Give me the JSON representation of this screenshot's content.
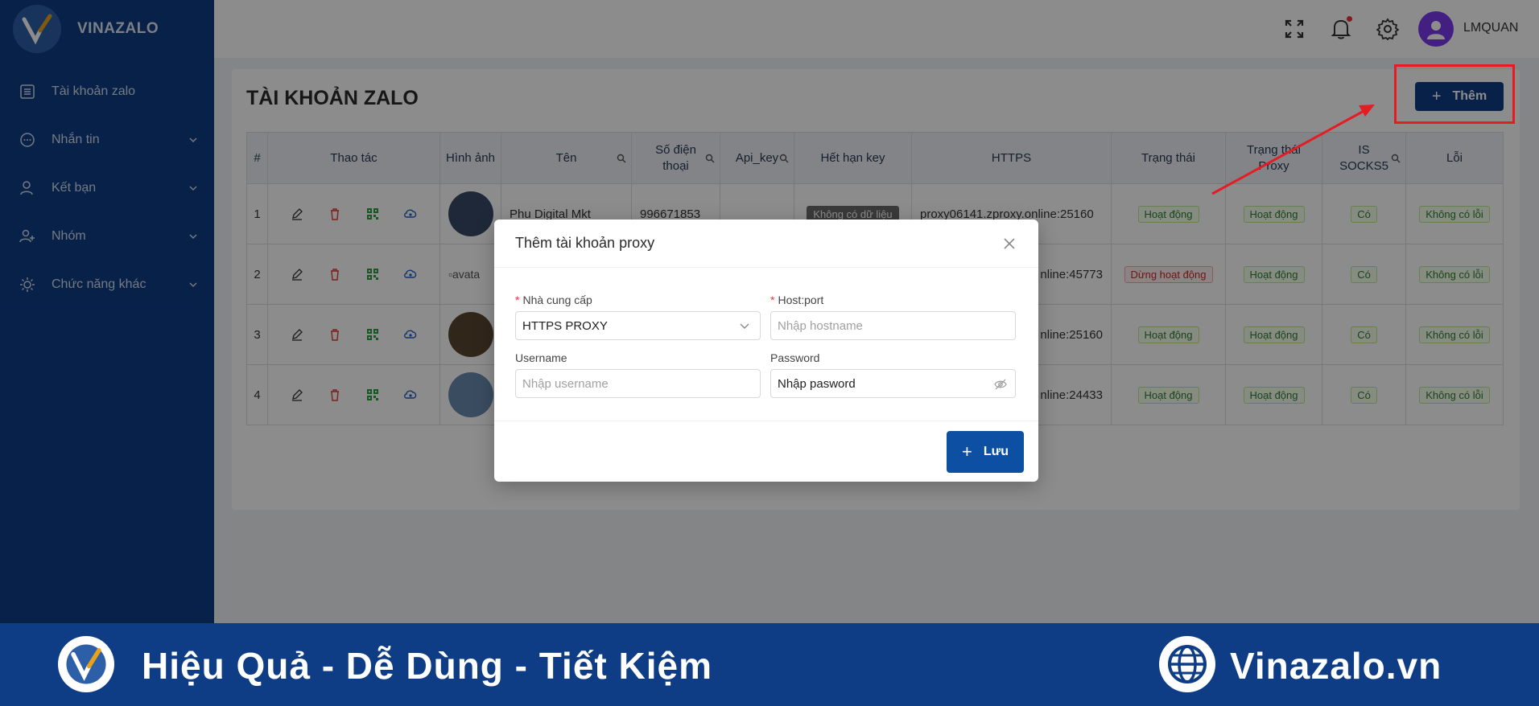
{
  "app": {
    "brand": "VINAZALO",
    "username": "LMQUAN"
  },
  "sidebar": {
    "items": [
      {
        "label": "Tài khoản zalo",
        "icon": "list-icon"
      },
      {
        "label": "Nhắn tin",
        "icon": "chat-icon"
      },
      {
        "label": "Kết bạn",
        "icon": "user-icon"
      },
      {
        "label": "Nhóm",
        "icon": "group-icon"
      },
      {
        "label": "Chức năng khác",
        "icon": "sun-icon"
      }
    ]
  },
  "page": {
    "title": "TÀI KHOẢN ZALO",
    "add_label": "Thêm"
  },
  "table": {
    "headers": [
      "#",
      "Thao tác",
      "Hình ảnh",
      "Tên",
      "Số điện thoại",
      "Api_key",
      "Hết hạn key",
      "HTTPS",
      "Trạng thái",
      "Trạng thái Proxy",
      "IS SOCKS5",
      "Lỗi"
    ],
    "rows": [
      {
        "index": "1",
        "name": "Phu Digital Mkt",
        "phone": "996671853",
        "expiry": "Không có dữ liệu",
        "https": "proxy06141.zproxy.online:25160",
        "status": "Hoạt động",
        "proxy_status": "Hoạt động",
        "socks5": "Có",
        "error": "Không có lỗi"
      },
      {
        "index": "2",
        "image_alt": "avata",
        "https": "nline:45773",
        "status": "Dừng hoạt động",
        "proxy_status": "Hoạt động",
        "socks5": "Có",
        "error": "Không có lỗi"
      },
      {
        "index": "3",
        "https": "nline:25160",
        "status": "Hoạt động",
        "proxy_status": "Hoạt động",
        "socks5": "Có",
        "error": "Không có lỗi"
      },
      {
        "index": "4",
        "https": "nline:24433",
        "status": "Hoạt động",
        "proxy_status": "Hoạt động",
        "socks5": "Có",
        "error": "Không có lỗi"
      }
    ]
  },
  "modal": {
    "title": "Thêm tài khoản proxy",
    "provider_label": "Nhà cung cấp",
    "provider_value": "HTTPS PROXY",
    "host_label": "Host:port",
    "host_placeholder": "Nhập hostname",
    "username_label": "Username",
    "username_placeholder": "Nhập username",
    "password_label": "Password",
    "password_value": "Nhập pasword",
    "save_label": "Lưu"
  },
  "banner": {
    "slogan": "Hiệu Quả - Dễ Dùng - Tiết Kiệm",
    "site": "Vinazalo.vn"
  },
  "colors": {
    "sidebar": "#0e3d86",
    "primary": "#0d3d85",
    "annotation": "#e51c23"
  }
}
